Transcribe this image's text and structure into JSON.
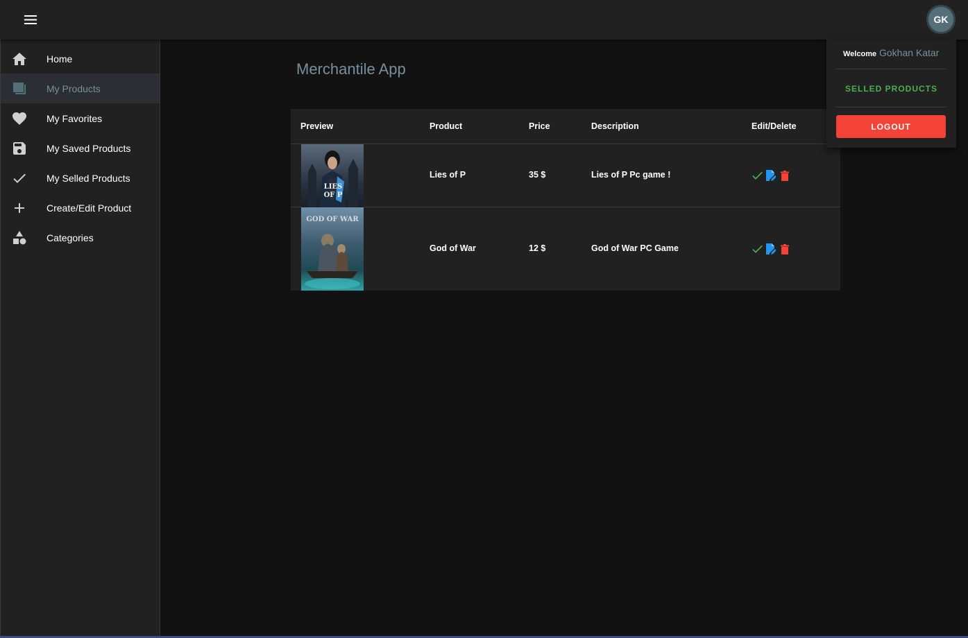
{
  "appbar": {
    "avatar_initials": "GK"
  },
  "sidebar": {
    "items": [
      {
        "label": "Home",
        "icon": "home-icon"
      },
      {
        "label": "My Products",
        "icon": "products-icon"
      },
      {
        "label": "My Favorites",
        "icon": "heart-icon"
      },
      {
        "label": "My Saved Products",
        "icon": "save-icon"
      },
      {
        "label": "My Selled Products",
        "icon": "check-icon"
      },
      {
        "label": "Create/Edit Product",
        "icon": "plus-icon"
      },
      {
        "label": "Categories",
        "icon": "shapes-icon"
      }
    ],
    "active_index": 1
  },
  "main": {
    "title": "Merchantile App",
    "table": {
      "headers": [
        "Preview",
        "Product",
        "Price",
        "Description",
        "Edit/Delete"
      ],
      "rows": [
        {
          "product": "Lies of P",
          "price": "35 $",
          "description": "Lies of P Pc game !",
          "preview_text": "LIES OF P"
        },
        {
          "product": "God of War",
          "price": "12 $",
          "description": "God of War PC Game",
          "preview_text": "GOD OF WAR"
        }
      ]
    }
  },
  "user_menu": {
    "welcome_label": "Welcome",
    "user_name": "Gokhan Katar",
    "selled_label": "SELLED PRODUCTS",
    "logout_label": "LOGOUT"
  },
  "colors": {
    "accent": "#78909c",
    "success": "#4caf50",
    "edit": "#2196f3",
    "danger": "#f44336"
  }
}
